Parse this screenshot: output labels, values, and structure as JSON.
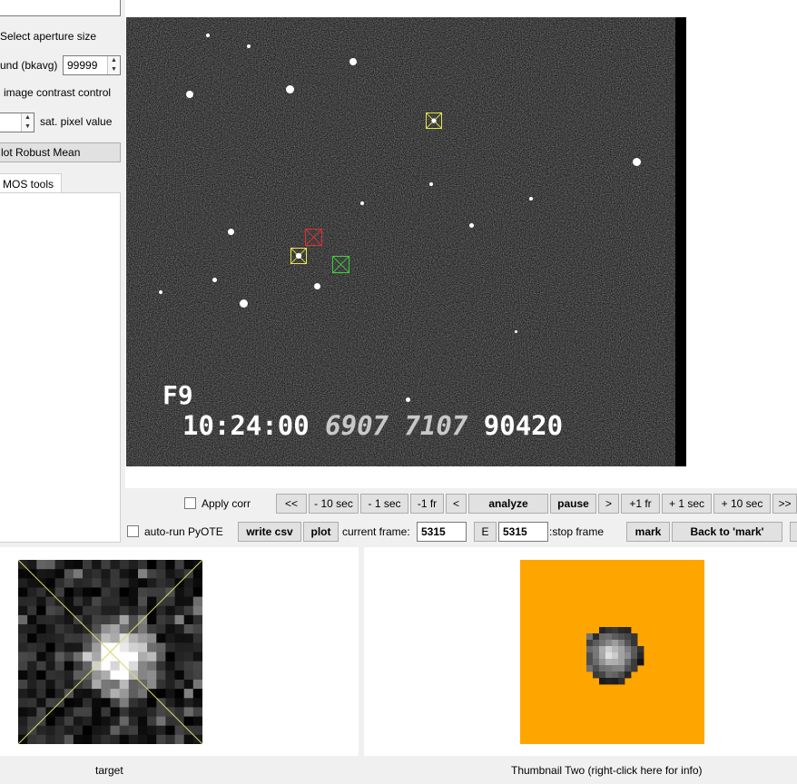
{
  "left_panel": {
    "aperture_button": "Select aperture size",
    "background_label": "und (bkavg)",
    "background_value": "99999",
    "contrast_label": "image contrast control",
    "sat_label": "sat. pixel value",
    "robust_mean_button": "lot Robust Mean",
    "tab_label": "MOS tools"
  },
  "video": {
    "frame_label": "F9",
    "timestamp": "10:24:00",
    "code_a": "6907",
    "code_b": "7107",
    "code_c": "90420"
  },
  "controls_row1": {
    "apply_corr": "Apply corr",
    "back_end": "<<",
    "minus_10_sec": "- 10 sec",
    "minus_1_sec": "- 1 sec",
    "minus_1_fr": "-1 fr",
    "back_one": "<",
    "analyze": "analyze",
    "pause": "pause",
    "forward_one": ">",
    "plus_1_fr": "+1 fr",
    "plus_1_sec": "+ 1 sec",
    "plus_10_sec": "+ 10 sec",
    "forward_end": ">>"
  },
  "controls_row2": {
    "auto_run": "auto-run PyOTE",
    "write_csv": "write csv",
    "plot": "plot",
    "current_frame_label": "current frame:",
    "current_frame_value": "5315",
    "e_button": "E",
    "stop_frame_value": "5315",
    "stop_frame_label": ":stop frame",
    "mark": "mark",
    "back_to_mark": "Back to 'mark'"
  },
  "thumbnails": {
    "one_caption": "target",
    "two_caption": "Thumbnail Two (right-click here for info)",
    "two_background": "#ffa500"
  },
  "markers": {
    "yellow": "#e8e84a",
    "red": "#e03030",
    "green": "#40d040"
  }
}
